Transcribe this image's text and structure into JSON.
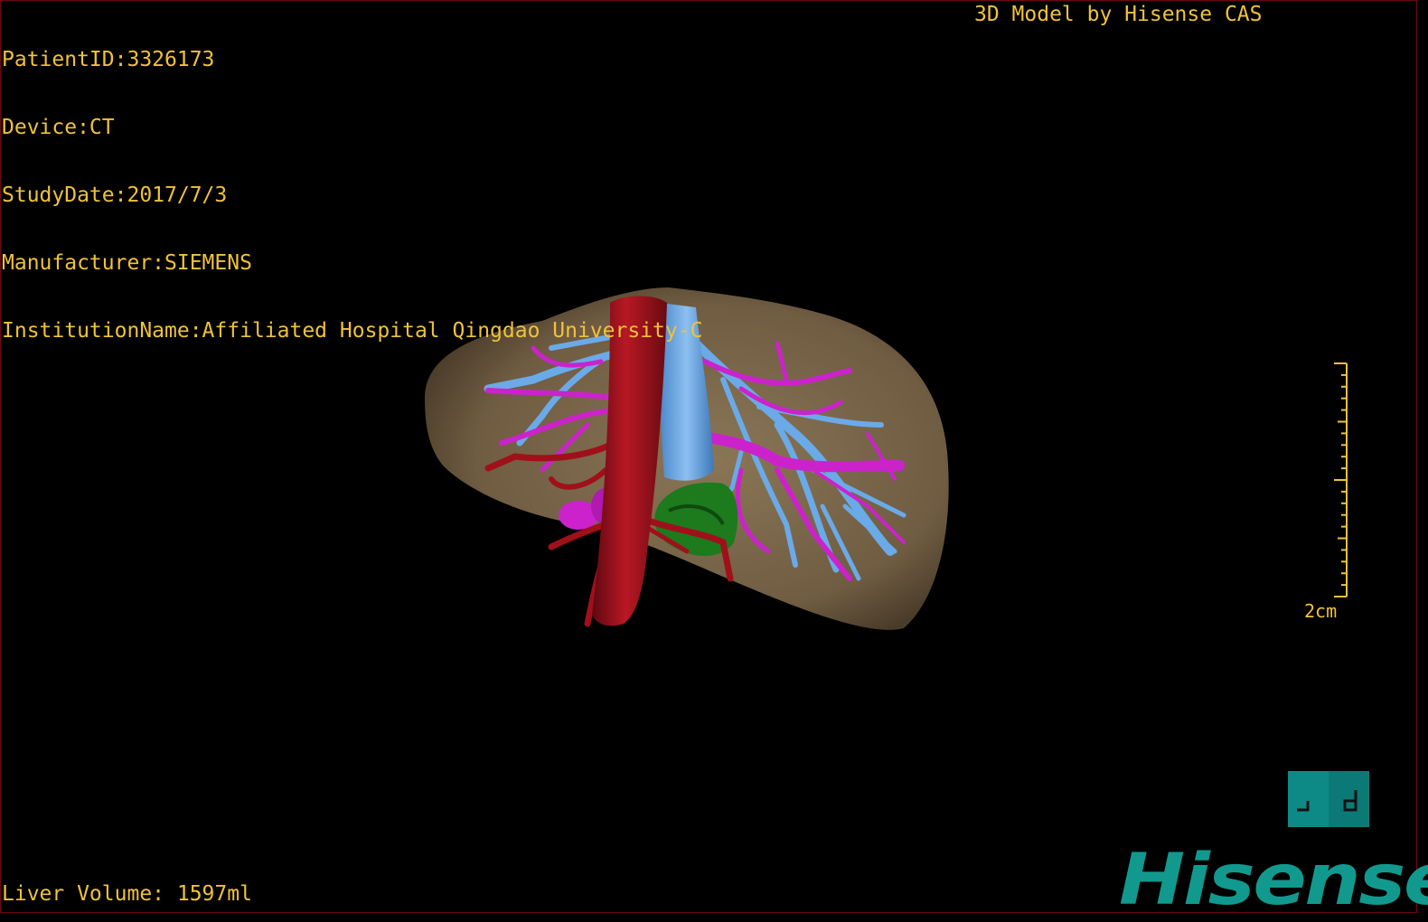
{
  "patient_info": [
    "PatientID:3326173",
    "Device:CT",
    "StudyDate:2017/7/3",
    "Manufacturer:SIEMENS",
    "InstitutionName:Affiliated Hospital Qingdao University-C"
  ],
  "credit": "3D Model by Hisense CAS",
  "liver_volume": "Liver Volume: 1597ml",
  "scale_bar": {
    "label": "2cm"
  },
  "logo_text": "Hisense",
  "model_colors": {
    "liver": "#7d6a4e",
    "artery": "#a0101a",
    "vein_blue": "#5aa0e0",
    "portal_vein": "#cc22cc",
    "green_structure": "#1e7a1e"
  },
  "view_toggle": {
    "icon": "ld-view-toggle-icon"
  },
  "colors": {
    "overlay_text": "#f0c23a",
    "brand": "#11998e"
  }
}
